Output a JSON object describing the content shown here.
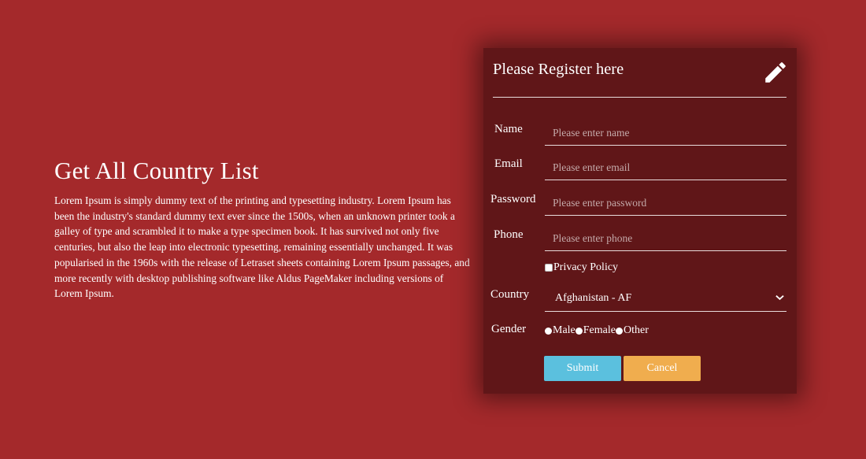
{
  "intro": {
    "heading": "Get All Country List",
    "body": "Lorem Ipsum is simply dummy text of the printing and typesetting industry. Lorem Ipsum has been the industry's standard dummy text ever since the 1500s, when an unknown printer took a galley of type and scrambled it to make a type specimen book. It has survived not only five centuries, but also the leap into electronic typesetting, remaining essentially unchanged. It was popularised in the 1960s with the release of Letraset sheets containing Lorem Ipsum passages, and more recently with desktop publishing software like Aldus PageMaker including versions of Lorem Ipsum."
  },
  "form": {
    "title": "Please Register here",
    "header_icon": "pencil-icon",
    "fields": {
      "name": {
        "label": "Name",
        "placeholder": "Please enter name",
        "value": ""
      },
      "email": {
        "label": "Email",
        "placeholder": "Please enter email",
        "value": ""
      },
      "password": {
        "label": "Password",
        "placeholder": "Please enter password",
        "value": ""
      },
      "phone": {
        "label": "Phone",
        "placeholder": "Please enter phone",
        "value": ""
      }
    },
    "privacy_label": "Privacy Policy",
    "privacy_checked": false,
    "country": {
      "label": "Country",
      "selected": "Afghanistan - AF"
    },
    "gender": {
      "label": "Gender",
      "options": [
        "Male",
        "Female",
        "Other"
      ]
    },
    "buttons": {
      "submit": "Submit",
      "cancel": "Cancel"
    }
  },
  "colors": {
    "background": "#a4292b",
    "panel": "#601618",
    "submit": "#5bc0de",
    "cancel": "#f0ad4e"
  }
}
